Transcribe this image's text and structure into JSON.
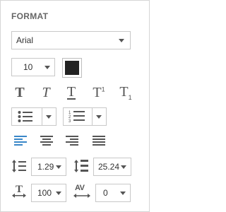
{
  "panel": {
    "title": "FORMAT",
    "font_family": {
      "value": "Arial"
    },
    "font_size": {
      "value": "10"
    },
    "color_swatch": {
      "color": "#222222"
    },
    "text_styles": {
      "items": [
        {
          "icon": "bold-t-icon",
          "glyph": "T"
        },
        {
          "icon": "italic-t-icon",
          "glyph": "T"
        },
        {
          "icon": "underline-t-icon",
          "glyph": "T"
        },
        {
          "icon": "superscript-icon",
          "glyph": "T",
          "mark": "1"
        },
        {
          "icon": "subscript-icon",
          "glyph": "T",
          "mark": "1"
        }
      ]
    },
    "lists": {
      "bullet": {
        "icon": "bullet-list-icon"
      },
      "numbered": {
        "icon": "numbered-list-icon"
      }
    },
    "alignment": {
      "active": "left",
      "active_color": "#3a87c8",
      "items": [
        "align-left-icon",
        "align-center-icon",
        "align-right-icon",
        "align-justify-icon"
      ]
    },
    "line_spacing": {
      "icon": "line-spacing-icon",
      "value": "1.29"
    },
    "paragraph_spacing": {
      "icon": "paragraph-spacing-icon",
      "value": "25.24"
    },
    "character_scale": {
      "icon": "character-scale-icon",
      "value": "100"
    },
    "character_spacing": {
      "icon": "character-spacing-icon",
      "label": "AV",
      "value": "0"
    }
  }
}
